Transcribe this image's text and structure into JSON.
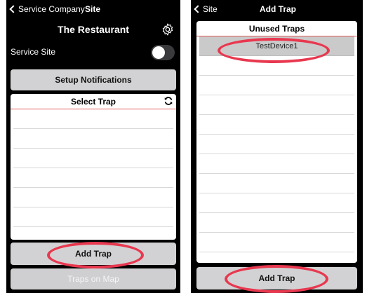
{
  "left_screen": {
    "nav": {
      "back_label": "Service Company",
      "title": "Site"
    },
    "page_title": "The Restaurant",
    "service_site": {
      "label": "Service Site",
      "enabled": false
    },
    "setup_notifications_label": "Setup Notifications",
    "select_trap": {
      "header": "Select Trap",
      "rows": [
        "",
        "",
        "",
        "",
        "",
        "",
        ""
      ]
    },
    "add_trap_label": "Add Trap",
    "traps_on_map_label": "Traps on Map"
  },
  "right_screen": {
    "nav": {
      "back_label": "Site",
      "title": "Add Trap"
    },
    "unused_traps": {
      "header": "Unused Traps",
      "rows": [
        "TestDevice1",
        "",
        "",
        "",
        "",
        "",
        "",
        "",
        "",
        "",
        ""
      ]
    },
    "add_trap_label": "Add Trap"
  },
  "annotation_color": "#e8384f"
}
